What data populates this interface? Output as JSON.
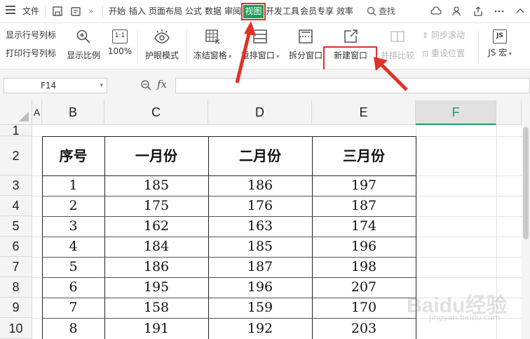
{
  "menu": {
    "file": "文件",
    "more": "»",
    "tabs": [
      "开始",
      "插入",
      "页面布局",
      "公式",
      "数据",
      "审阅",
      "视图",
      "开发工具",
      "会员专享",
      "效率"
    ],
    "active_tab": "视图",
    "search": "查找"
  },
  "ribbon": {
    "row_col_label_1": "显示行号列标",
    "row_col_label_2": "打印行号列标",
    "zoom_ratio": "显示比例",
    "zoom_100_icon": "1:1",
    "zoom_100": "100%",
    "eye_mode": "护眼模式",
    "freeze": "冻结窗格",
    "arrange": "重排窗口",
    "split": "拆分窗口",
    "new_window": "新建窗口",
    "side_by_side": "并排比较",
    "sync_scroll": "同步滚动",
    "reset_position": "重设位置",
    "macro_icon": "JS",
    "macro": "JS 宏"
  },
  "formula_bar": {
    "name_box": "F14",
    "fx": "fx",
    "formula": ""
  },
  "sheet": {
    "columns": [
      "A",
      "B",
      "C",
      "D",
      "E",
      "F"
    ],
    "active_column": "F",
    "rows": [
      "1",
      "2",
      "3",
      "4",
      "5",
      "6",
      "7",
      "8",
      "9",
      "10"
    ],
    "table_header": [
      "序号",
      "一月份",
      "二月份",
      "三月份"
    ],
    "table_rows": [
      [
        "1",
        "185",
        "186",
        "197"
      ],
      [
        "2",
        "175",
        "176",
        "187"
      ],
      [
        "3",
        "162",
        "163",
        "174"
      ],
      [
        "4",
        "184",
        "185",
        "196"
      ],
      [
        "5",
        "186",
        "187",
        "198"
      ],
      [
        "6",
        "195",
        "196",
        "207"
      ],
      [
        "7",
        "158",
        "159",
        "170"
      ],
      [
        "8",
        "191",
        "192",
        "203"
      ]
    ]
  },
  "watermark": {
    "main": "Baidu经验",
    "sub": "jingyan.baidu.com"
  },
  "colors": {
    "accent_green": "#1e9e5a",
    "annotation_red": "#e0312a"
  }
}
